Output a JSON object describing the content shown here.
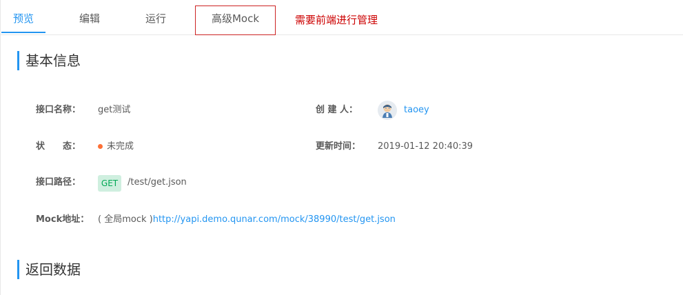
{
  "tabs": [
    {
      "label": "预览",
      "active": true
    },
    {
      "label": "编辑",
      "active": false
    },
    {
      "label": "运行",
      "active": false
    },
    {
      "label": "高级Mock",
      "active": false
    }
  ],
  "annotation": "需要前端进行管理",
  "basic_info": {
    "section_title": "基本信息",
    "name_label": "接口名称：",
    "name_value": "get测试",
    "creator_label": "创 建 人：",
    "creator_value": "taoey",
    "status_label": "状　　态：",
    "status_value": "未完成",
    "status_color": "#fd7036",
    "updated_label": "更新时间：",
    "updated_value": "2019-01-12 20:40:39",
    "path_label": "接口路径：",
    "method": "GET",
    "path_value": "/test/get.json",
    "mock_label": "Mock地址：",
    "mock_prefix": "( 全局mock )",
    "mock_url": "http://yapi.demo.qunar.com/mock/38990/test/get.json"
  },
  "return_section_title": "返回数据",
  "colors": {
    "accent": "#2395f1",
    "annotation": "#cc0000",
    "get_badge_bg": "#cfefdf",
    "get_badge_text": "#00a854"
  }
}
